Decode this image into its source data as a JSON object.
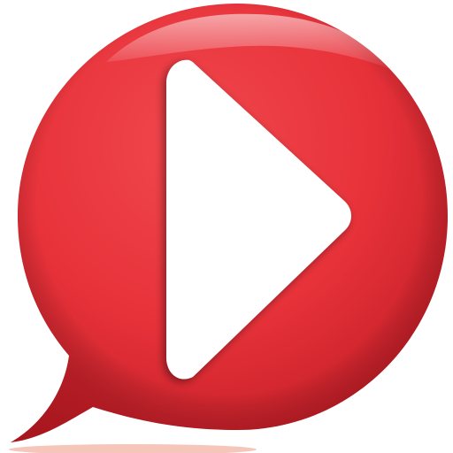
{
  "icon": {
    "name": "play-speech-bubble-icon",
    "shape": "speech-bubble",
    "symbol": "play-triangle",
    "colors": {
      "background": "#ffffff",
      "bubble_base": "#e8323a",
      "bubble_light": "#f26a70",
      "bubble_dark": "#b01820",
      "highlight": "#ffffff",
      "play_symbol": "#ffffff",
      "bottom_shadow": "#f2b8a8"
    }
  }
}
